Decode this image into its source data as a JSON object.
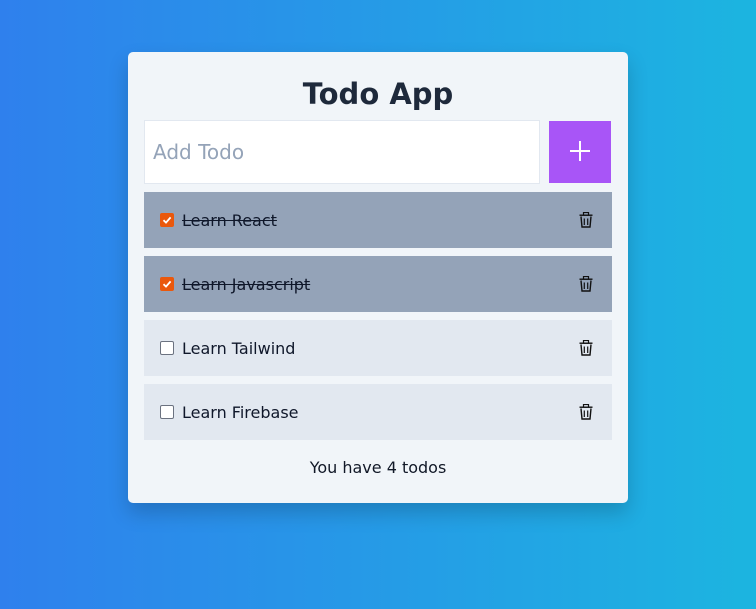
{
  "app": {
    "title": "Todo App",
    "input": {
      "placeholder": "Add Todo",
      "value": ""
    },
    "add_button": {
      "icon": "plus-icon"
    },
    "todos": [
      {
        "label": "Learn React",
        "completed": true
      },
      {
        "label": "Learn Javascript",
        "completed": true
      },
      {
        "label": "Learn Tailwind",
        "completed": false
      },
      {
        "label": "Learn Firebase",
        "completed": false
      }
    ],
    "delete_icon": "trash-icon",
    "count_text": "You have 4 todos"
  },
  "colors": {
    "gradient_start": "#2f80ed",
    "gradient_end": "#1cb5e0",
    "add_button": "#a855f7",
    "checkbox_checked": "#ea580c",
    "item_done": "#94a3b8",
    "item_open": "#e2e8f0"
  }
}
